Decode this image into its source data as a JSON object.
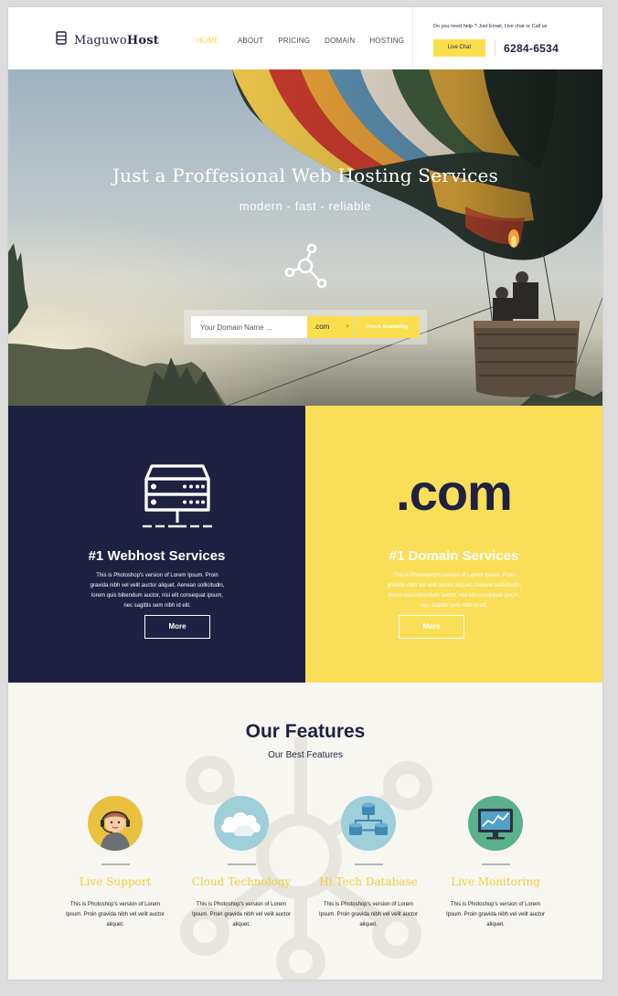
{
  "header": {
    "logo_prefix": "Maguwo",
    "logo_suffix": "Host",
    "nav": [
      "HOME",
      "ABOUT",
      "PRICING",
      "DOMAIN",
      "HOSTING"
    ],
    "help_text": "Do you need help ? Just Email, Live chat or Call us",
    "live_chat_label": "Live Chat",
    "phone": "6284-6534"
  },
  "hero": {
    "title": "Just a Proffesional Web Hosting Services",
    "subtitle": "modern  -  fast  -  reliable",
    "search_placeholder": "Your Domain Name ...",
    "tld_selected": ".com",
    "check_label": "Check Availability"
  },
  "services": {
    "webhost": {
      "title": "#1 Webhost Services",
      "desc": "This is Photoshop's version  of Lorem Ipsum. Proin gravida nibh vel velit auctor aliquet. Aenean sollicitudin, lorem quis bibendum auctor, nisi elit consequat ipsum, nec sagittis sem nibh id elit.",
      "more_label": "More"
    },
    "domain": {
      "badge": ".com",
      "title": "#1 Domain Services",
      "desc": "This is Photoshop's version  of Lorem Ipsum. Proin gravida nibh vel velit auctor aliquet. Aenean sollicitudin, lorem quis bibendum auctor, nisi elit consequat ipsum, nec sagittis sem nibh id elit.",
      "more_label": "More"
    }
  },
  "features": {
    "title": "Our Features",
    "subtitle": "Our Best Features",
    "items": [
      {
        "name": "Live Support",
        "icon": "support-agent-icon",
        "desc": "This is Photoshop's version  of Lorem Ipsum. Proin gravida nibh vel velit auctor aliquet."
      },
      {
        "name": "Cloud Technology",
        "icon": "cloud-icon",
        "desc": "This is Photoshop's version  of Lorem Ipsum. Proin gravida nibh vel velit auctor aliquet."
      },
      {
        "name": "Hi Tech Database",
        "icon": "database-icon",
        "desc": "This is Photoshop's version  of Lorem Ipsum. Proin gravida nibh vel velit auctor aliquet."
      },
      {
        "name": "Live Monitoring",
        "icon": "monitor-icon",
        "desc": "This is Photoshop's version  of Lorem Ipsum. Proin gravida nibh vel velit auctor aliquet."
      }
    ]
  },
  "colors": {
    "navy": "#1f2142",
    "yellow": "#fbde58",
    "feature_title": "#f2cd3e"
  }
}
